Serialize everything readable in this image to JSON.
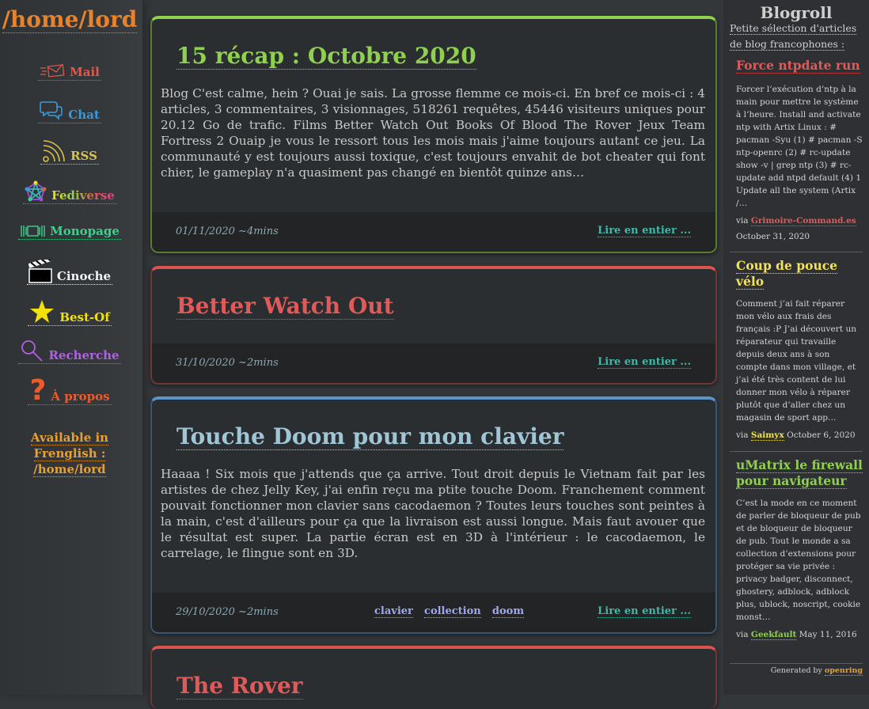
{
  "site": {
    "title": "/home/lord"
  },
  "nav": [
    {
      "label": "Mail",
      "color": "#e05a4f",
      "icon": "mail-icon"
    },
    {
      "label": "Chat",
      "color": "#3a9ad9",
      "icon": "chat-icon"
    },
    {
      "label": "RSS",
      "color": "#d9c24a",
      "icon": "rss-icon"
    },
    {
      "label": "Fediverse",
      "icon": "fediverse-icon"
    },
    {
      "label": "Monopage",
      "color": "#3fcf8e",
      "icon": "monopage-icon"
    },
    {
      "label": "Cinoche",
      "color": "#f2f2f2",
      "icon": "clapperboard-icon"
    },
    {
      "label": "Best-Of",
      "color": "#f2e10b",
      "icon": "star-icon"
    },
    {
      "label": "Recherche",
      "color": "#b060e0",
      "icon": "magnifier-icon"
    },
    {
      "label": "À propos",
      "color": "#f05a28",
      "icon": "question-icon"
    }
  ],
  "available": {
    "line1": "Available in",
    "line2": "Frenglish :",
    "line3": "/home/lord"
  },
  "articles": [
    {
      "title": "15 récap : Octobre 2020",
      "title_color": "#8fd14f",
      "border_color": "#8fd14f",
      "text": "Blog C'est calme, hein ? Ouai je sais. La grosse flemme ce mois-ci. En bref ce mois-ci : 4 articles, 3 commentaires, 3 visionnages, 518261 requêtes, 45446 visiteurs uniques pour 20.12 Go de trafic. Films Better Watch Out Books Of Blood The Rover Jeux Team Fortress 2 Ouaip je vous le ressort tous les mois mais j'aime toujours autant ce jeu. La communauté y est toujours aussi toxique, c'est toujours envahit de bot cheater qui font chier, le gameplay n'a quasiment pas changé en bientôt quinze ans…",
      "date": "01/11/2020 ~4mins",
      "more": "Lire en entier ...",
      "tags": []
    },
    {
      "title": "Better Watch Out",
      "title_color": "#e05a5a",
      "border_color": "#d9534f",
      "text": "",
      "date": "31/10/2020 ~2mins",
      "more": "Lire en entier ...",
      "tags": []
    },
    {
      "title": "Touche Doom pour mon clavier",
      "title_color": "#9fc6d6",
      "border_color": "#5a94c8",
      "text": "Haaaa ! Six mois que j'attends que ça arrive. Tout droit depuis le Vietnam fait par les artistes de chez Jelly Key, j'ai enfin reçu ma ptite touche Doom. Franchement comment pouvait fonctionner mon clavier sans cacodaemon ? Toutes leurs touches sont peintes à la main, c'est d'ailleurs pour ça que la livraison est aussi longue. Mais faut avouer que le résultat est super. La partie écran est en 3D à l'intérieur : le cacodaemon, le carrelage, le flingue sont en 3D.",
      "date": "29/10/2020 ~2mins",
      "more": "Lire en entier ...",
      "tags": [
        "clavier",
        "collection",
        "doom"
      ]
    },
    {
      "title": "The Rover",
      "title_color": "#e05a5a",
      "border_color": "#d9534f"
    }
  ],
  "blogroll": {
    "title": "Blogroll",
    "subtitle_line1": "Petite sélection d'articles",
    "subtitle_line2": "de blog francophones :",
    "items": [
      {
        "title_line1": "Force ntpdate run",
        "title_line2": "",
        "color": "#e05a5a",
        "text": "Forcer l’exécution d’ntp à la main pour mettre le système à l’heure. Install and activate ntp with Artix Linux : # pacman -Syu (1) # pacman -S ntp-openrc (2) # rc-update show -v | grep ntp (3) # rc-update add ntpd default (4) 1 Update all the system (Artix /…",
        "via": "via",
        "source": "Grimoire-Command.es",
        "source_color": "#e05a5a",
        "date": "October 31, 2020"
      },
      {
        "title_line1": "Coup de pouce",
        "title_line2": "vélo",
        "color": "#f2e25a",
        "text": "Comment j’ai fait réparer mon vélo aux frais des français :P J’ai découvert un réparateur qui travaille depuis deux ans à son compte dans mon village, et j’ai été très content de lui donner mon vélo à réparer plutôt que d’aller chez un magasin de sport app…",
        "via": "via",
        "source": "Saimyx",
        "source_color": "#f2e25a",
        "date": "October 6, 2020"
      },
      {
        "title_line1": "uMatrix le firewall",
        "title_line2": "pour navigateur",
        "color": "#8fd14f",
        "text": "C’est la mode en ce moment de parler de bloqueur de pub et de bloqueur de bloqueur de pub. Tout le monde a sa collection d’extensions pour protéger sa vie privée : privacy badger, disconnect, ghostery, adblock, adblock plus, ublock, noscript, cookie monst…",
        "via": "via",
        "source": "Geekfault",
        "source_color": "#8fd14f",
        "date": "May 11, 2016"
      }
    ],
    "generated_by": "Generated by",
    "generator": "openring"
  }
}
